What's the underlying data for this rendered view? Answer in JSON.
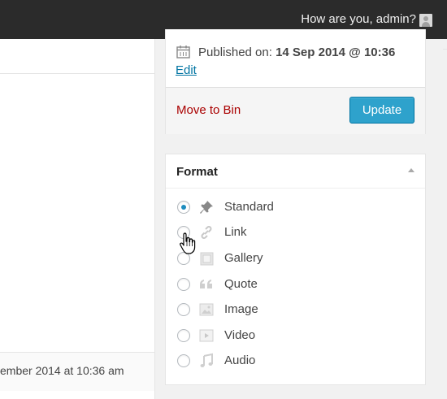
{
  "admin_bar": {
    "greeting": "How are you, admin?",
    "avatar_icon": "avatar-icon"
  },
  "left_panel": {
    "footer_text": "ember 2014 at 10:36 am"
  },
  "publish": {
    "published_label": "Published on:",
    "published_date": "14 Sep 2014 @ 10:36",
    "edit_label": "Edit",
    "move_to_bin": "Move to Bin",
    "update_label": "Update"
  },
  "format": {
    "title": "Format",
    "options": [
      {
        "label": "Standard",
        "icon": "pin-icon",
        "checked": true
      },
      {
        "label": "Link",
        "icon": "link-icon",
        "checked": false
      },
      {
        "label": "Gallery",
        "icon": "gallery-icon",
        "checked": false
      },
      {
        "label": "Quote",
        "icon": "quote-icon",
        "checked": false
      },
      {
        "label": "Image",
        "icon": "image-icon",
        "checked": false
      },
      {
        "label": "Video",
        "icon": "video-icon",
        "checked": false
      },
      {
        "label": "Audio",
        "icon": "audio-icon",
        "checked": false
      }
    ]
  },
  "colors": {
    "accent": "#2ea2cc",
    "link": "#0074a2",
    "danger": "#aa0000",
    "adminbar": "#2b2b2b"
  }
}
